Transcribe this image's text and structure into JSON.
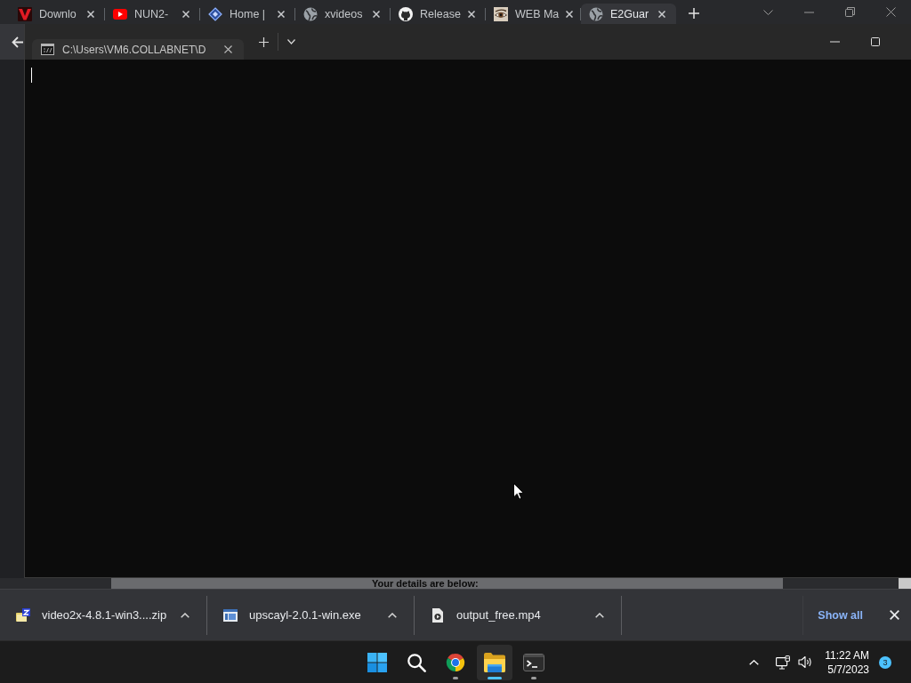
{
  "browser": {
    "tabs": [
      {
        "title": "Downlo",
        "kind": "logo",
        "selected": false
      },
      {
        "title": "NUN2-",
        "kind": "play",
        "selected": false
      },
      {
        "title": "Home |",
        "kind": "diamond",
        "selected": false
      },
      {
        "title": "xvideos",
        "kind": "globe",
        "selected": false
      },
      {
        "title": "Release",
        "kind": "cat",
        "selected": false
      },
      {
        "title": "WEB Ma",
        "kind": "eye",
        "selected": false
      },
      {
        "title": "E2Guar",
        "kind": "globe",
        "selected": true
      }
    ],
    "page_text": "Your details are below:"
  },
  "terminal": {
    "tab": {
      "title": "C:\\Users\\VM6.COLLABNET\\D"
    }
  },
  "downloads": {
    "items": [
      {
        "file_name": "video2x-4.8.1-win3....zip",
        "kind": "archive"
      },
      {
        "file_name": "upscayl-2.0.1-win.exe",
        "kind": "program"
      },
      {
        "file_name": "output_free.mp4",
        "kind": "video"
      }
    ],
    "show_all": "Show all"
  },
  "taskbar": {
    "apps": [
      {
        "kind": "start",
        "open": false,
        "selected": false
      },
      {
        "kind": "search",
        "open": false,
        "selected": false
      },
      {
        "kind": "browser",
        "open": true,
        "selected": false
      },
      {
        "kind": "folder",
        "open": true,
        "selected": true
      },
      {
        "kind": "terminal",
        "open": true,
        "selected": false
      }
    ],
    "time": "11:22 AM",
    "date": "5/7/2023",
    "notifications": "3"
  }
}
